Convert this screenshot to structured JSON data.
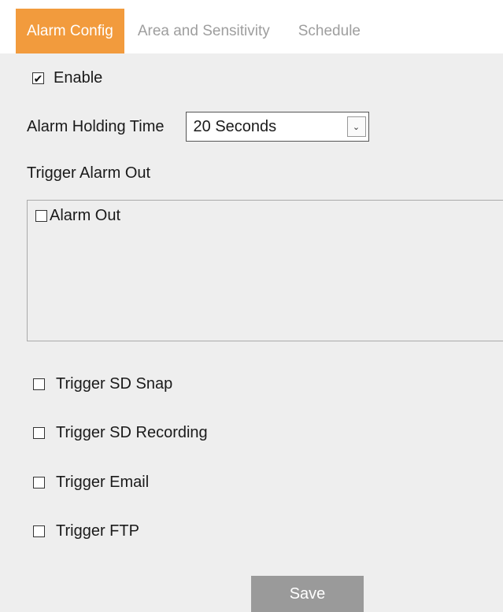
{
  "tabs": [
    {
      "label": "Alarm Config",
      "active": true
    },
    {
      "label": "Area and Sensitivity",
      "active": false
    },
    {
      "label": "Schedule",
      "active": false
    }
  ],
  "enable": {
    "label": "Enable",
    "checked": true
  },
  "alarm_holding_time": {
    "label": "Alarm Holding Time",
    "value": "20 Seconds"
  },
  "trigger_alarm_out": {
    "title": "Trigger Alarm Out",
    "items": [
      {
        "label": "Alarm Out",
        "checked": false
      }
    ]
  },
  "options": [
    {
      "label": "Trigger SD Snap",
      "checked": false
    },
    {
      "label": "Trigger SD Recording",
      "checked": false
    },
    {
      "label": "Trigger Email",
      "checked": false
    },
    {
      "label": "Trigger FTP",
      "checked": false
    }
  ],
  "save_label": "Save",
  "colors": {
    "accent": "#f29b3d",
    "save_button": "#9a9a9a",
    "background": "#eeeeee"
  }
}
